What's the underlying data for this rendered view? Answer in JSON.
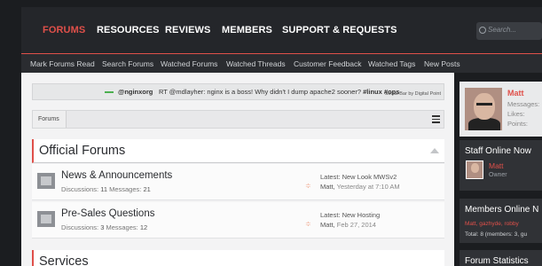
{
  "nav": {
    "tabs": [
      {
        "label": "FORUMS",
        "active": true
      },
      {
        "label": "RESOURCES",
        "active": false
      },
      {
        "label": "REVIEWS",
        "active": false
      },
      {
        "label": "MEMBERS",
        "active": false
      },
      {
        "label": "SUPPORT & REQUESTS",
        "active": false
      }
    ],
    "search_placeholder": "Search..."
  },
  "subnav": {
    "links": [
      "Mark Forums Read",
      "Search Forums",
      "Watched Forums",
      "Watched Threads",
      "Customer Feedback",
      "Watched Tags",
      "New Posts"
    ]
  },
  "socialbar": {
    "handle": "@nginxorg",
    "tweet_prefix": "RT @mdlayher: nginx is a boss! Why didn't I dump apache2 sooner? ",
    "tweet_tags": "#linux #ops",
    "credit": "Social Bar by Digital Point"
  },
  "breadcrumb": {
    "item": "Forums"
  },
  "categories": [
    {
      "title": "Official Forums",
      "forums": [
        {
          "title": "News & Announcements",
          "discussions_label": "Discussions:",
          "discussions": "11",
          "messages_label": "Messages:",
          "messages": "21",
          "latest": "Latest: New Look MWSv2",
          "author": "Matt",
          "time": "Yesterday at 7:10 AM"
        },
        {
          "title": "Pre-Sales Questions",
          "discussions_label": "Discussions:",
          "discussions": "3",
          "messages_label": "Messages:",
          "messages": "12",
          "latest": "Latest: New Hosting",
          "author": "Matt",
          "time": "Feb 27, 2014"
        }
      ]
    },
    {
      "title": "Services"
    }
  ],
  "sidebar": {
    "user": {
      "name": "Matt",
      "labels": [
        "Messages:",
        "Likes:",
        "Points:"
      ]
    },
    "staff": {
      "title": "Staff Online Now",
      "name": "Matt",
      "role": "Owner"
    },
    "members_online": {
      "title": "Members Online N",
      "list": "Matt, gazhyde, robby",
      "total": "Total: 8 (members: 3, gu"
    },
    "stats": {
      "title": "Forum Statistics"
    }
  },
  "colors": {
    "accent": "#e0504a",
    "dark_bg": "#1b1d20",
    "panel_bg": "#f3f3f4"
  },
  "icons": [
    "search-icon",
    "menu-icon",
    "collapse-icon",
    "forum-icon",
    "rss-icon",
    "avatar"
  ]
}
